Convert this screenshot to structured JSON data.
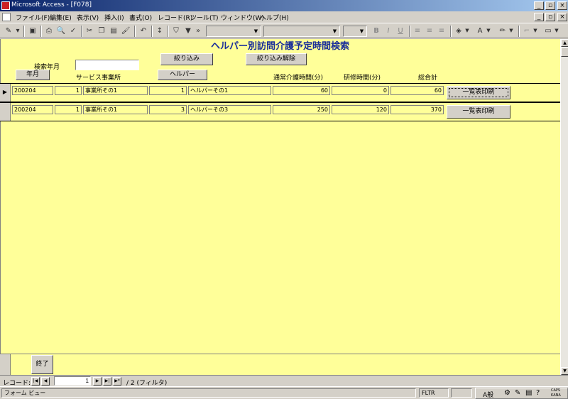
{
  "window": {
    "title": "Microsoft Access - [F078]"
  },
  "menu": [
    "ファイル(F)",
    "編集(E)",
    "表示(V)",
    "挿入(I)",
    "書式(O)",
    "レコード(R)",
    "ツール(T)",
    "ウィンドウ(W)",
    "ヘルプ(H)"
  ],
  "form": {
    "title": "ヘルパー別訪問介護予定時間検索",
    "search_label": "検索年月",
    "search_value": "",
    "filter_button": "絞り込み",
    "clear_filter_button": "絞り込み解除",
    "header": {
      "year_month": "年月",
      "service_office": "サービス事業所",
      "helper": "ヘルパー",
      "normal_time": "通常介護時間(分)",
      "training_time": "研修時間(分)",
      "total": "総合計"
    },
    "rows": [
      {
        "year_month": "200204",
        "office_id": "1",
        "office_name": "事業所その1",
        "helper_id": "1",
        "helper_name": "ヘルパーその1",
        "normal": "60",
        "training": "0",
        "total": "60",
        "print_button": "一覧表印刷",
        "current": true
      },
      {
        "year_month": "200204",
        "office_id": "1",
        "office_name": "事業所その1",
        "helper_id": "3",
        "helper_name": "ヘルパーその3",
        "normal": "250",
        "training": "120",
        "total": "370",
        "print_button": "一覧表印刷",
        "current": false
      }
    ],
    "exit_button": "終了"
  },
  "navigation": {
    "label": "レコード:",
    "current": "1",
    "total_text": "/ 2 (フィルタ)"
  },
  "status": {
    "view": "フォーム ビュー",
    "filter": "FLTR",
    "ime": "A般",
    "caps": "CAPS",
    "kana": "KANA"
  },
  "colors": {
    "form_bg": "#ffff99",
    "title_color": "#1a2e9a",
    "titlebar": "#0a246a"
  }
}
